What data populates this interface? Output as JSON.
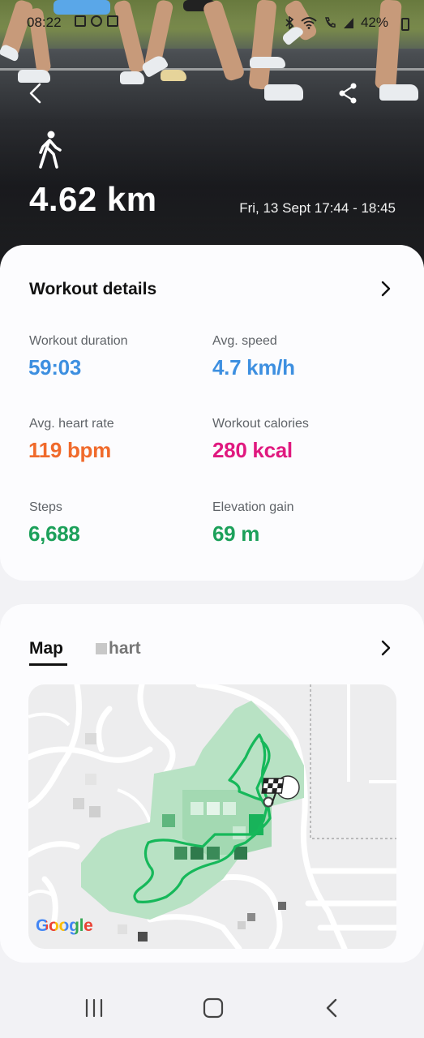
{
  "status_bar": {
    "time": "08:22",
    "battery": "42%"
  },
  "workout": {
    "activity_icon": "walking-person-icon",
    "distance": "4.62 km",
    "datetime": "Fri, 13 Sept 17:44 - 18:45"
  },
  "details": {
    "title": "Workout details",
    "stats": [
      {
        "label": "Workout duration",
        "value": "59:03",
        "color": "#3d8fe0"
      },
      {
        "label": "Avg. speed",
        "value": "4.7 km/h",
        "color": "#3d8fe0"
      },
      {
        "label": "Avg. heart rate",
        "value": "119 bpm",
        "color": "#f06a2b"
      },
      {
        "label": "Workout calories",
        "value": "280 kcal",
        "color": "#e0197f"
      },
      {
        "label": "Steps",
        "value": "6,688",
        "color": "#1ca05a"
      },
      {
        "label": "Elevation gain",
        "value": "69 m",
        "color": "#1ca05a"
      }
    ]
  },
  "map_card": {
    "tab_map": "Map",
    "tab_chart": "hart",
    "map_attribution": "Google"
  },
  "icons": {
    "back": "back-arrow-icon",
    "share": "share-icon",
    "chevron": "chevron-right-icon",
    "finish": "checkered-flag-icon"
  },
  "colors": {
    "route": "#16b85a",
    "park": "#b8e2c4",
    "accent_blue": "#3d8fe0"
  }
}
